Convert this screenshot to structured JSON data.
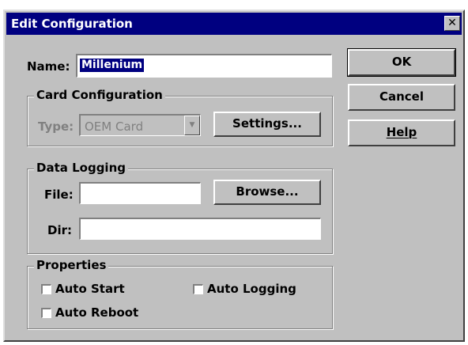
{
  "dialog": {
    "title": "Edit Configuration",
    "close_glyph": "✕"
  },
  "name": {
    "label": "Name:",
    "value": "Millenium"
  },
  "card_configuration": {
    "group_title": "Card Configuration",
    "type_label": "Type:",
    "type_value": "OEM Card",
    "settings_button": "Settings..."
  },
  "data_logging": {
    "group_title": "Data Logging",
    "file_label": "File:",
    "file_value": "",
    "browse_button": "Browse...",
    "dir_label": "Dir:",
    "dir_value": ""
  },
  "properties": {
    "group_title": "Properties",
    "checkboxes": [
      {
        "label": "Auto Start",
        "checked": false
      },
      {
        "label": "Auto Logging",
        "checked": false
      },
      {
        "label": "Auto Reboot",
        "checked": false
      }
    ]
  },
  "buttons": {
    "ok": "OK",
    "cancel": "Cancel",
    "help": "Help"
  }
}
